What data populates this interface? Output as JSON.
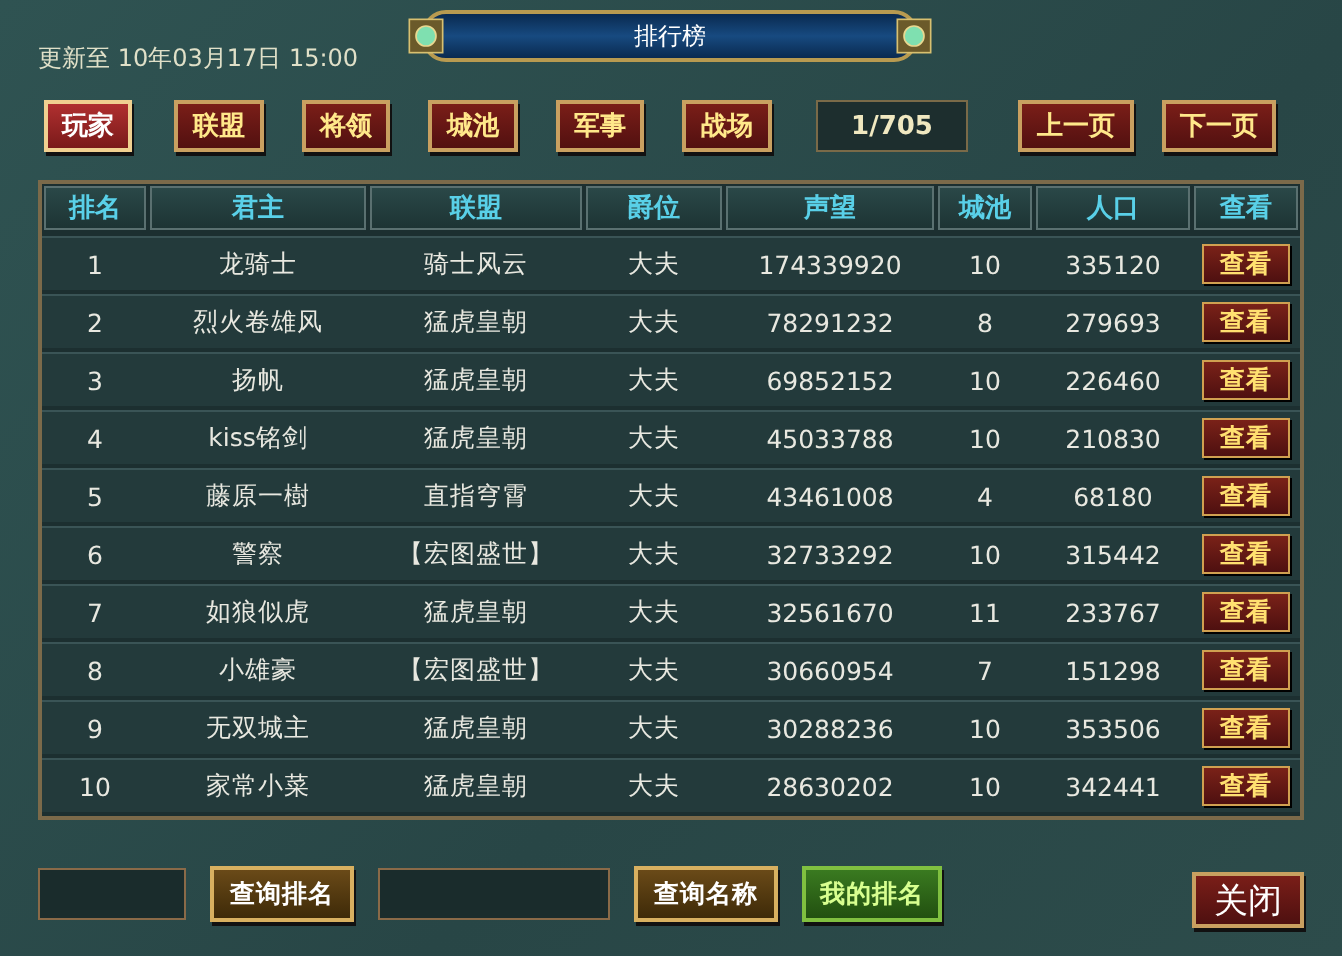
{
  "window": {
    "title": "排行榜"
  },
  "updated": "更新至 10年03月17日 15:00",
  "tabs": [
    {
      "label": "玩家",
      "selected": true
    },
    {
      "label": "联盟",
      "selected": false
    },
    {
      "label": "将领",
      "selected": false
    },
    {
      "label": "城池",
      "selected": false
    },
    {
      "label": "军事",
      "selected": false
    },
    {
      "label": "战场",
      "selected": false
    }
  ],
  "page": "1/705",
  "pager": [
    "上一页",
    "下一页"
  ],
  "table": {
    "columns": [
      "排名",
      "君主",
      "联盟",
      "爵位",
      "声望",
      "城池",
      "人口",
      "查看"
    ],
    "rows": [
      {
        "cells": [
          "1",
          "龙骑士",
          "骑士风云",
          "大夫",
          "174339920",
          "10",
          "335120"
        ],
        "action": "查看"
      },
      {
        "cells": [
          "2",
          "烈火卷雄风",
          "猛虎皇朝",
          "大夫",
          "78291232",
          "8",
          "279693"
        ],
        "action": "查看"
      },
      {
        "cells": [
          "3",
          "扬帆",
          "猛虎皇朝",
          "大夫",
          "69852152",
          "10",
          "226460"
        ],
        "action": "查看"
      },
      {
        "cells": [
          "4",
          "kiss铭剑",
          "猛虎皇朝",
          "大夫",
          "45033788",
          "10",
          "210830"
        ],
        "action": "查看"
      },
      {
        "cells": [
          "5",
          "藤原一樹",
          "直指穹霄",
          "大夫",
          "43461008",
          "4",
          "68180"
        ],
        "action": "查看"
      },
      {
        "cells": [
          "6",
          "警察",
          "【宏图盛世】",
          "大夫",
          "32733292",
          "10",
          "315442"
        ],
        "action": "查看"
      },
      {
        "cells": [
          "7",
          "如狼似虎",
          "猛虎皇朝",
          "大夫",
          "32561670",
          "11",
          "233767"
        ],
        "action": "查看"
      },
      {
        "cells": [
          "8",
          "小雄豪",
          "【宏图盛世】",
          "大夫",
          "30660954",
          "7",
          "151298"
        ],
        "action": "查看"
      },
      {
        "cells": [
          "9",
          "无双城主",
          "猛虎皇朝",
          "大夫",
          "30288236",
          "10",
          "353506"
        ],
        "action": "查看"
      },
      {
        "cells": [
          "10",
          "家常小菜",
          "猛虎皇朝",
          "大夫",
          "28630202",
          "10",
          "342441"
        ],
        "action": "查看"
      }
    ]
  },
  "bottom": [
    {
      "kind": "input"
    },
    {
      "kind": "button",
      "label": "查询排名"
    },
    {
      "kind": "input"
    },
    {
      "kind": "button",
      "label": "查询名称"
    },
    {
      "kind": "green",
      "label": "我的排名"
    }
  ],
  "close": "关闭"
}
